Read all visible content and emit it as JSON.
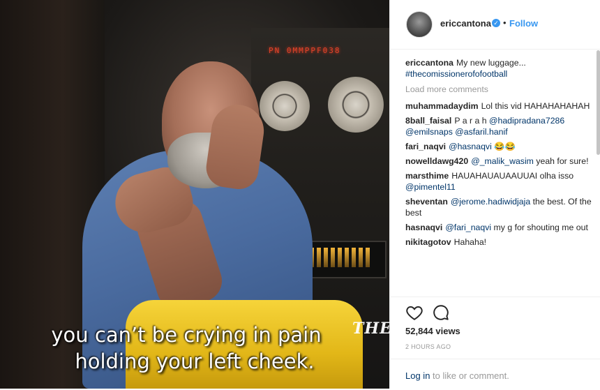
{
  "video": {
    "led_readout": "PN 0MMPPF038",
    "watermark": "THE",
    "subtitle_line1": "you can’t be crying in pain",
    "subtitle_line2": "holding your left cheek."
  },
  "header": {
    "username": "ericcantona",
    "separator": "•",
    "follow_label": "Follow"
  },
  "caption": {
    "user": "ericcantona",
    "text": "My new luggage...",
    "hashtag": "#thecomissionerofofootball"
  },
  "load_more": "Load more comments",
  "comments": [
    {
      "user": "muhammadaydim",
      "parts": [
        {
          "t": "Lol this vid HAHAHAHAHAH",
          "k": "text"
        }
      ]
    },
    {
      "user": "8ball_faisal",
      "parts": [
        {
          "t": "P a r a h ",
          "k": "text"
        },
        {
          "t": "@hadipradana7286",
          "k": "mention"
        },
        {
          "t": " ",
          "k": "text"
        },
        {
          "t": "@emilsnaps",
          "k": "mention"
        },
        {
          "t": " ",
          "k": "text"
        },
        {
          "t": "@asfaril.hanif",
          "k": "mention"
        }
      ]
    },
    {
      "user": "fari_naqvi",
      "parts": [
        {
          "t": "@hasnaqvi",
          "k": "mention"
        },
        {
          "t": " 😂😂",
          "k": "text"
        }
      ]
    },
    {
      "user": "nowelldawg420",
      "parts": [
        {
          "t": "@_malik_wasim",
          "k": "mention"
        },
        {
          "t": " yeah for sure!",
          "k": "text"
        }
      ]
    },
    {
      "user": "marsthime",
      "parts": [
        {
          "t": "HAUAHAUAUAAUUAI olha isso ",
          "k": "text"
        },
        {
          "t": "@pimentel11",
          "k": "mention"
        }
      ]
    },
    {
      "user": "sheventan",
      "parts": [
        {
          "t": "@jerome.hadiwidjaja",
          "k": "mention"
        },
        {
          "t": " the best. Of the best",
          "k": "text"
        }
      ]
    },
    {
      "user": "hasnaqvi",
      "parts": [
        {
          "t": "@fari_naqvi",
          "k": "mention"
        },
        {
          "t": " my g for shouting me out",
          "k": "text"
        }
      ]
    },
    {
      "user": "nikitagotov",
      "parts": [
        {
          "t": "Hahaha!",
          "k": "text"
        }
      ]
    }
  ],
  "stats": {
    "views": "52,844 views",
    "timestamp": "2 HOURS AGO"
  },
  "login": {
    "link_text": "Log in",
    "rest_text": " to like or comment."
  },
  "colors": {
    "accent": "#3897f0",
    "mention": "#003569",
    "muted": "#999999",
    "text": "#262626"
  },
  "icons": [
    "verified-badge-icon",
    "heart-icon",
    "comment-bubble-icon"
  ]
}
